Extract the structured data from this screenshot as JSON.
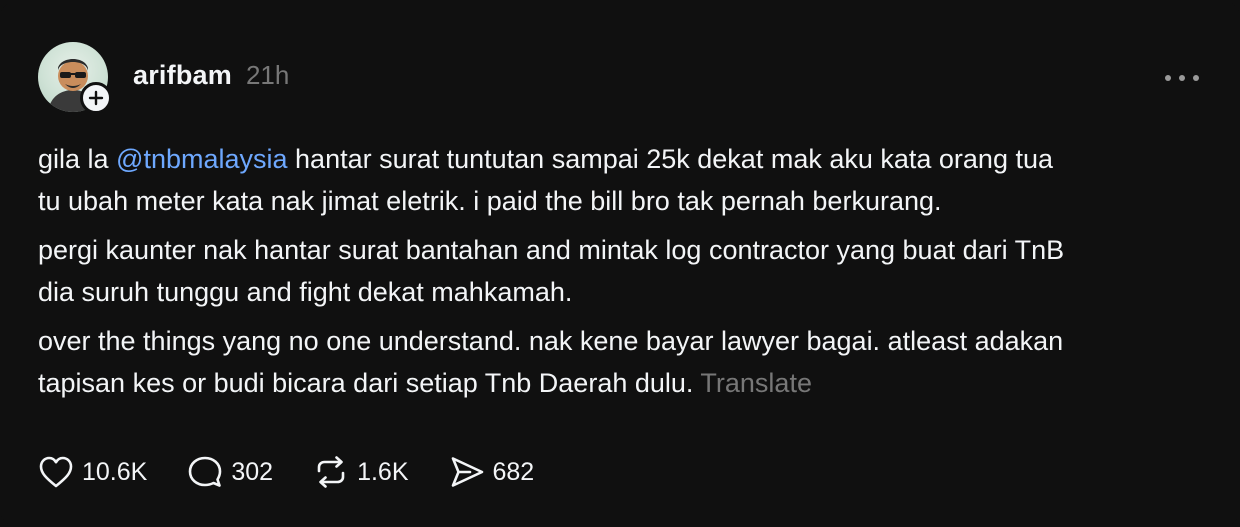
{
  "post": {
    "username": "arifbam",
    "timestamp": "21h",
    "paragraphs": [
      {
        "pre": "gila la ",
        "mention": "@tnbmalaysia",
        "post": " hantar surat tuntutan sampai 25k dekat mak aku kata orang tua\ntu ubah meter kata nak jimat eletrik. i paid the bill bro tak pernah berkurang."
      },
      {
        "text": "pergi kaunter nak hantar surat bantahan and mintak log contractor yang buat dari TnB\ndia suruh tunggu and fight dekat mahkamah."
      },
      {
        "text": "over the things yang no one understand. nak kene bayar lawyer bagai. atleast adakan\ntapisan kes or budi bicara dari setiap Tnb Daerah dulu. ",
        "translate": "Translate"
      }
    ],
    "actions": {
      "likes": "10.6K",
      "replies": "302",
      "reposts": "1.6K",
      "shares": "682"
    }
  },
  "icons": {
    "avatar": "avatar-person-sunglasses",
    "follow": "plus-icon",
    "more": "more-horizontal-icon",
    "like": "heart-icon",
    "reply": "comment-icon",
    "repost": "repost-icon",
    "share": "send-icon"
  },
  "colors": {
    "background": "#101010",
    "text": "#f3f5f7",
    "muted": "#777777",
    "mention": "#6ea8fe"
  }
}
